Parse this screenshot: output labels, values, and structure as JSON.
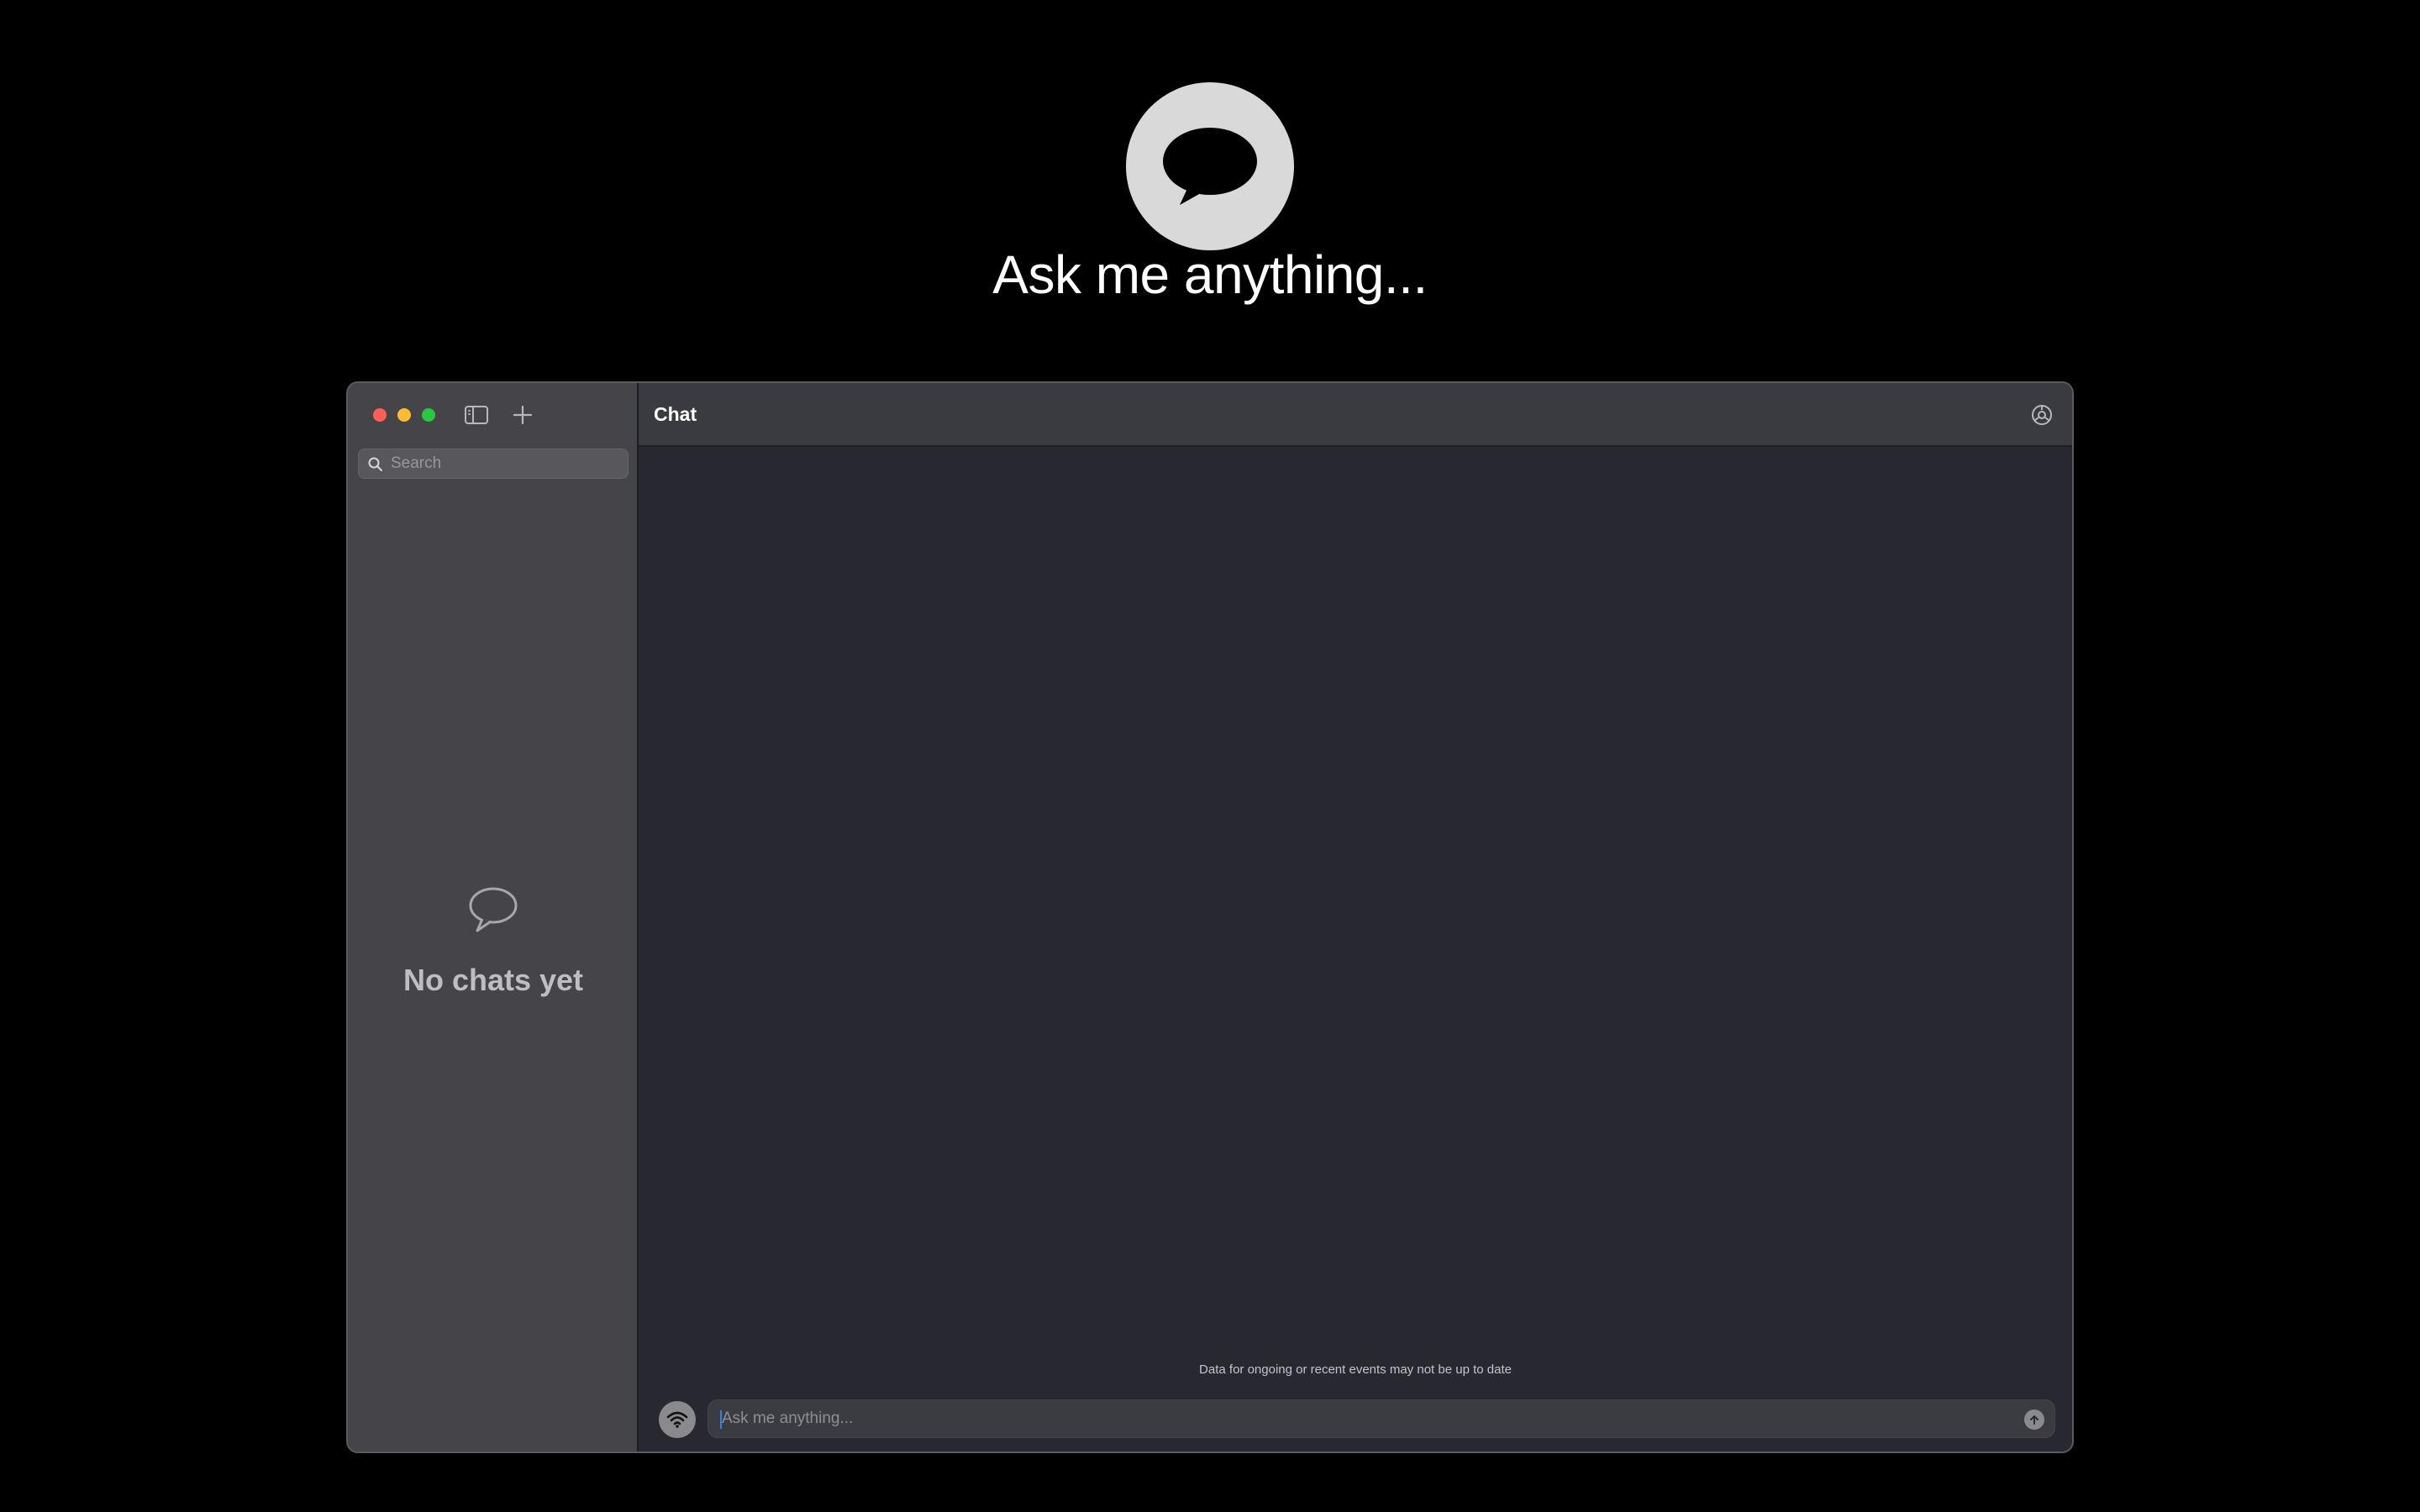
{
  "hero": {
    "title": "Ask me anything...",
    "logo_icon": "speech-bubble-icon"
  },
  "window": {
    "traffic_lights": {
      "close_color": "#fe5f57",
      "minimize_color": "#febc2e",
      "zoom_color": "#28c840"
    },
    "toolbar": {
      "toggle_sidebar_icon": "sidebar-toggle-icon",
      "new_chat_icon": "plus-icon"
    }
  },
  "sidebar": {
    "search": {
      "placeholder": "Search",
      "value": ""
    },
    "empty_state": {
      "icon": "speech-bubble-outline-icon",
      "text": "No chats yet"
    }
  },
  "main": {
    "title": "Chat",
    "settings_icon": "settings-icon",
    "disclaimer": "Data for ongoing or recent events may not be up to date",
    "composer": {
      "placeholder": "Ask me anything...",
      "value": "",
      "web_icon": "wifi-icon",
      "send_icon": "send-arrow-icon"
    }
  },
  "colors": {
    "background": "#000000",
    "sidebar": "#454549",
    "main": "#282830",
    "topbar": "#3a3a41",
    "accent_caret": "#2f7ff6"
  }
}
